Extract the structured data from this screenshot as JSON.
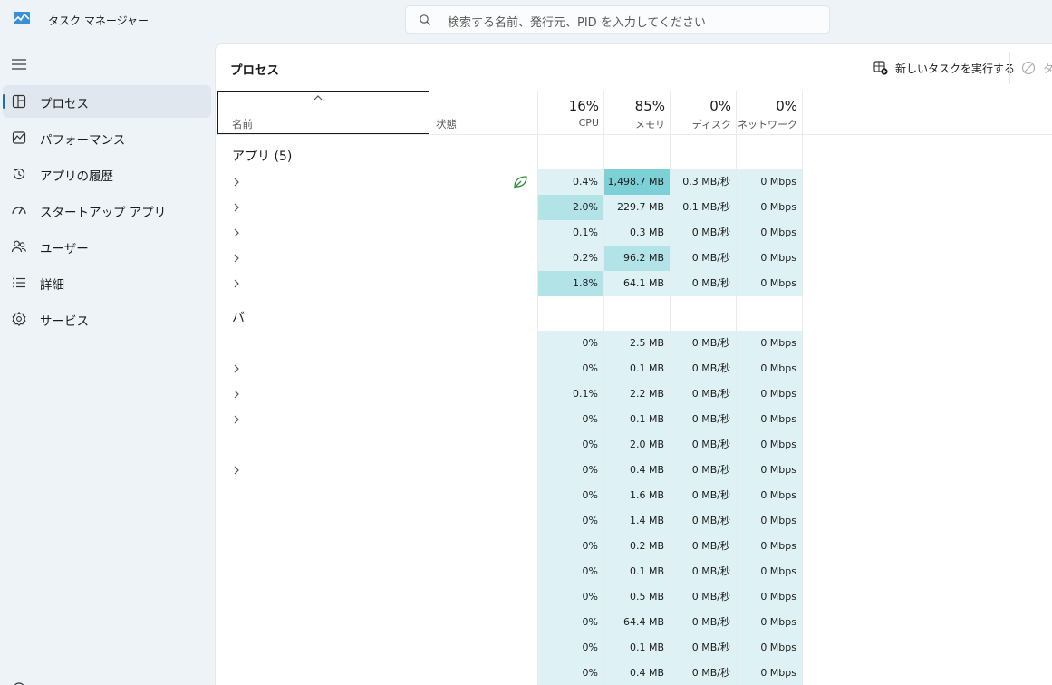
{
  "window": {
    "title": "タスク マネージャー"
  },
  "search": {
    "placeholder": "検索する名前、発行元、PID を入力してください"
  },
  "nav": {
    "items": [
      {
        "label": "プロセス",
        "icon": "processes-icon",
        "active": true
      },
      {
        "label": "パフォーマンス",
        "icon": "performance-icon",
        "active": false
      },
      {
        "label": "アプリの履歴",
        "icon": "app-history-icon",
        "active": false
      },
      {
        "label": "スタートアップ アプリ",
        "icon": "startup-icon",
        "active": false
      },
      {
        "label": "ユーザー",
        "icon": "users-icon",
        "active": false
      },
      {
        "label": "詳細",
        "icon": "details-icon",
        "active": false
      },
      {
        "label": "サービス",
        "icon": "services-icon",
        "active": false
      }
    ]
  },
  "page": {
    "title": "プロセス",
    "run_task_label": "新しいタスクを実行する",
    "end_task_label": "タ"
  },
  "columns": {
    "name": "名前",
    "status": "状態",
    "cpu": {
      "percent": "16%",
      "label": "CPU"
    },
    "memory": {
      "percent": "85%",
      "label": "メモリ"
    },
    "disk": {
      "percent": "0%",
      "label": "ディスク"
    },
    "network": {
      "percent": "0%",
      "label": "ネットワーク"
    }
  },
  "groups": {
    "apps": "アプリ (5)",
    "background": "バ"
  },
  "rows": [
    {
      "expand": true,
      "eco": true,
      "cpu": "0.4%",
      "mem": "1,498.7 MB",
      "disk": "0.3 MB/秒",
      "net": "0 Mbps",
      "cpu_heat": 1,
      "mem_heat": 3
    },
    {
      "expand": true,
      "eco": false,
      "cpu": "2.0%",
      "mem": "229.7 MB",
      "disk": "0.1 MB/秒",
      "net": "0 Mbps",
      "cpu_heat": 2,
      "mem_heat": 1
    },
    {
      "expand": true,
      "eco": false,
      "cpu": "0.1%",
      "mem": "0.3 MB",
      "disk": "0 MB/秒",
      "net": "0 Mbps",
      "cpu_heat": 1,
      "mem_heat": 1
    },
    {
      "expand": true,
      "eco": false,
      "cpu": "0.2%",
      "mem": "96.2 MB",
      "disk": "0 MB/秒",
      "net": "0 Mbps",
      "cpu_heat": 1,
      "mem_heat": 2
    },
    {
      "expand": true,
      "eco": false,
      "cpu": "1.8%",
      "mem": "64.1 MB",
      "disk": "0 MB/秒",
      "net": "0 Mbps",
      "cpu_heat": 2,
      "mem_heat": 1
    },
    {
      "expand": false,
      "eco": false,
      "cpu": "0%",
      "mem": "2.5 MB",
      "disk": "0 MB/秒",
      "net": "0 Mbps",
      "cpu_heat": 1,
      "mem_heat": 1
    },
    {
      "expand": true,
      "eco": false,
      "cpu": "0%",
      "mem": "0.1 MB",
      "disk": "0 MB/秒",
      "net": "0 Mbps",
      "cpu_heat": 1,
      "mem_heat": 1
    },
    {
      "expand": true,
      "eco": false,
      "cpu": "0.1%",
      "mem": "2.2 MB",
      "disk": "0 MB/秒",
      "net": "0 Mbps",
      "cpu_heat": 1,
      "mem_heat": 1
    },
    {
      "expand": true,
      "eco": false,
      "cpu": "0%",
      "mem": "0.1 MB",
      "disk": "0 MB/秒",
      "net": "0 Mbps",
      "cpu_heat": 1,
      "mem_heat": 1
    },
    {
      "expand": false,
      "eco": false,
      "cpu": "0%",
      "mem": "2.0 MB",
      "disk": "0 MB/秒",
      "net": "0 Mbps",
      "cpu_heat": 1,
      "mem_heat": 1
    },
    {
      "expand": true,
      "eco": false,
      "cpu": "0%",
      "mem": "0.4 MB",
      "disk": "0 MB/秒",
      "net": "0 Mbps",
      "cpu_heat": 1,
      "mem_heat": 1
    },
    {
      "expand": false,
      "eco": false,
      "cpu": "0%",
      "mem": "1.6 MB",
      "disk": "0 MB/秒",
      "net": "0 Mbps",
      "cpu_heat": 1,
      "mem_heat": 1
    },
    {
      "expand": false,
      "eco": false,
      "cpu": "0%",
      "mem": "1.4 MB",
      "disk": "0 MB/秒",
      "net": "0 Mbps",
      "cpu_heat": 1,
      "mem_heat": 1
    },
    {
      "expand": false,
      "eco": false,
      "cpu": "0%",
      "mem": "0.2 MB",
      "disk": "0 MB/秒",
      "net": "0 Mbps",
      "cpu_heat": 1,
      "mem_heat": 1
    },
    {
      "expand": false,
      "eco": false,
      "cpu": "0%",
      "mem": "0.1 MB",
      "disk": "0 MB/秒",
      "net": "0 Mbps",
      "cpu_heat": 1,
      "mem_heat": 1
    },
    {
      "expand": false,
      "eco": false,
      "cpu": "0%",
      "mem": "0.5 MB",
      "disk": "0 MB/秒",
      "net": "0 Mbps",
      "cpu_heat": 1,
      "mem_heat": 1
    },
    {
      "expand": false,
      "eco": false,
      "cpu": "0%",
      "mem": "64.4 MB",
      "disk": "0 MB/秒",
      "net": "0 Mbps",
      "cpu_heat": 1,
      "mem_heat": 1
    },
    {
      "expand": false,
      "eco": false,
      "cpu": "0%",
      "mem": "0.1 MB",
      "disk": "0 MB/秒",
      "net": "0 Mbps",
      "cpu_heat": 1,
      "mem_heat": 1
    },
    {
      "expand": false,
      "eco": false,
      "cpu": "0%",
      "mem": "0.4 MB",
      "disk": "0 MB/秒",
      "net": "0 Mbps",
      "cpu_heat": 1,
      "mem_heat": 1
    }
  ],
  "colors": {
    "heat_1": "#def2f5",
    "heat_2": "#b2e3e7",
    "heat_3": "#7dd0d6",
    "accent": "#1f6eab",
    "eco_leaf": "#2e8b3a"
  }
}
